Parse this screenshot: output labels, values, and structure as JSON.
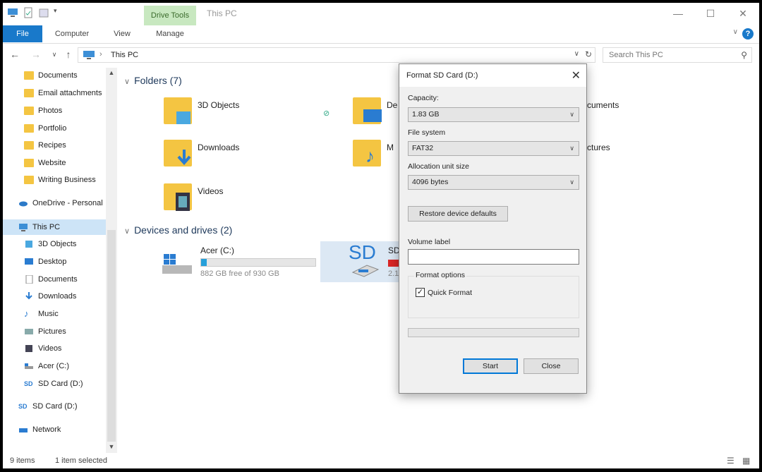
{
  "title_bar": {
    "contextual_tab": "Drive Tools",
    "window_title": "This PC"
  },
  "ribbon": {
    "tabs": [
      "File",
      "Computer",
      "View",
      "Manage"
    ]
  },
  "address_bar": {
    "location": "This PC",
    "search_placeholder": "Search This PC"
  },
  "sidebar": {
    "items": [
      {
        "label": "Documents",
        "icon": "folder-icon"
      },
      {
        "label": "Email attachments",
        "icon": "folder-icon"
      },
      {
        "label": "Photos",
        "icon": "folder-icon"
      },
      {
        "label": "Portfolio",
        "icon": "folder-icon"
      },
      {
        "label": "Recipes",
        "icon": "folder-icon"
      },
      {
        "label": "Website",
        "icon": "folder-icon"
      },
      {
        "label": "Writing Business",
        "icon": "folder-icon"
      },
      {
        "label": "OneDrive - Personal",
        "icon": "onedrive-icon"
      },
      {
        "label": "This PC",
        "icon": "pc-icon",
        "selected": true
      },
      {
        "label": "3D Objects",
        "icon": "3d-objects-icon"
      },
      {
        "label": "Desktop",
        "icon": "desktop-icon"
      },
      {
        "label": "Documents",
        "icon": "documents-icon"
      },
      {
        "label": "Downloads",
        "icon": "downloads-icon"
      },
      {
        "label": "Music",
        "icon": "music-icon"
      },
      {
        "label": "Pictures",
        "icon": "pictures-icon"
      },
      {
        "label": "Videos",
        "icon": "videos-icon"
      },
      {
        "label": "Acer (C:)",
        "icon": "drive-icon"
      },
      {
        "label": "SD Card (D:)",
        "icon": "sd-card-icon"
      },
      {
        "label": "SD Card (D:)",
        "icon": "sd-card-icon"
      },
      {
        "label": "Network",
        "icon": "network-icon"
      }
    ]
  },
  "content": {
    "folders_header": "Folders (7)",
    "folders": [
      "3D Objects",
      "De",
      "cuments",
      "Downloads",
      "M",
      "ctures",
      "Videos"
    ],
    "devices_header": "Devices and drives (2)",
    "drive_c": {
      "name": "Acer (C:)",
      "free": "882 GB free of 930 GB",
      "used_fraction": 0.05
    },
    "drive_d": {
      "name": "SD",
      "sd_label": "SD",
      "free_partial": "2.1"
    }
  },
  "status_bar": {
    "items_count": "9 items",
    "selection": "1 item selected"
  },
  "dialog": {
    "title": "Format SD Card (D:)",
    "capacity_label": "Capacity:",
    "capacity_value": "1.83 GB",
    "filesystem_label": "File system",
    "filesystem_value": "FAT32",
    "alloc_label": "Allocation unit size",
    "alloc_value": "4096 bytes",
    "restore_label": "Restore device defaults",
    "volume_label": "Volume label",
    "volume_value": "",
    "options_label": "Format options",
    "quick_format_label": "Quick Format",
    "quick_format_checked": true,
    "start_label": "Start",
    "close_label": "Close"
  },
  "colors": {
    "accent": "#1979ca",
    "drive_tools_tab": "#c8e8c0",
    "folder": "#f4c542",
    "selection": "#cde4f7",
    "drive_bar": "#26a0da"
  }
}
